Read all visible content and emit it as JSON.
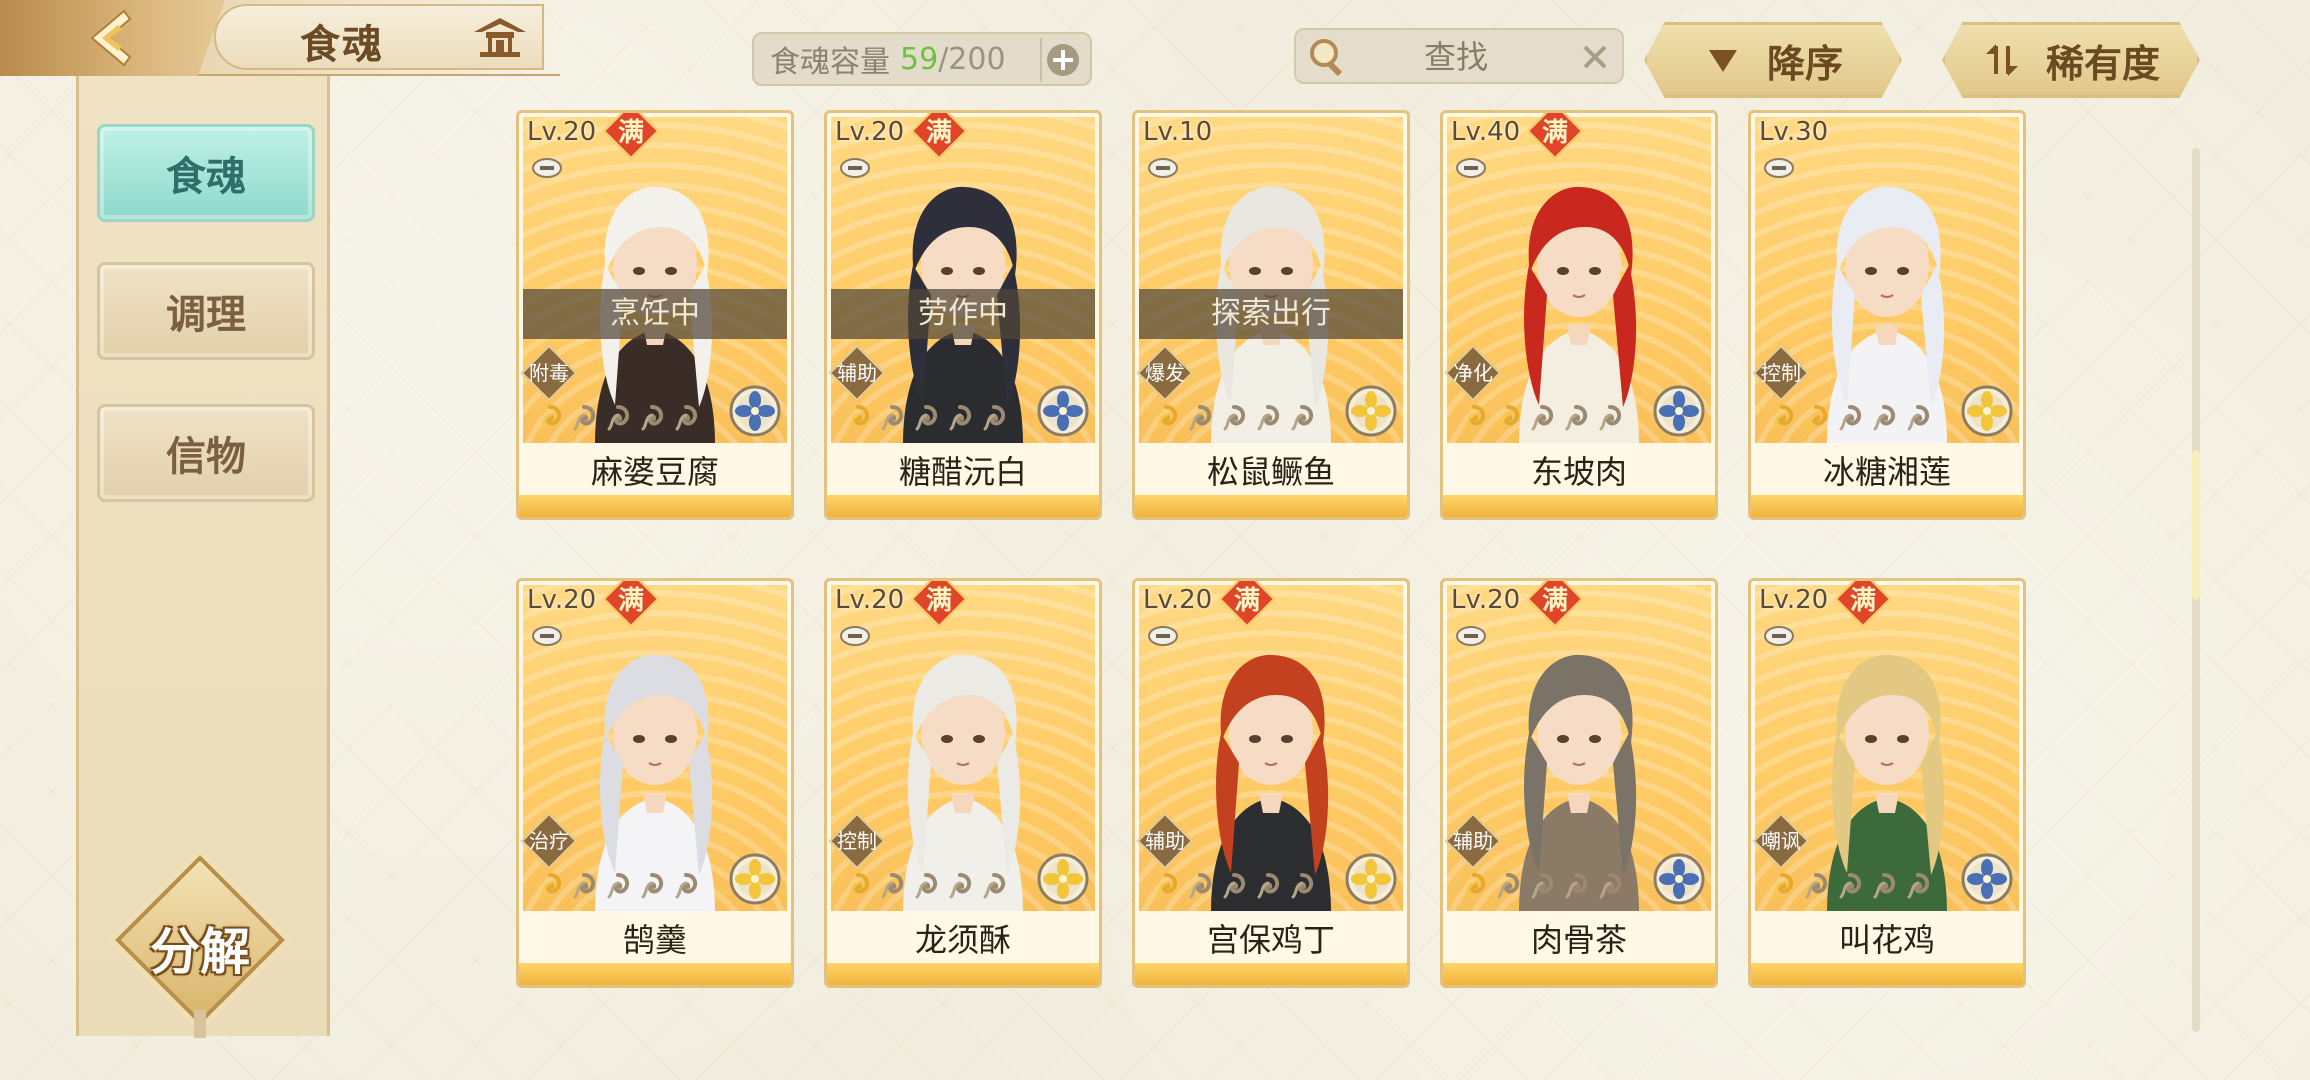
{
  "header": {
    "title": "食魂",
    "capacity": {
      "label": "食魂容量",
      "current": "59",
      "separator": "/",
      "max": "200"
    },
    "search": {
      "placeholder": "查找"
    },
    "sort_label": "降序",
    "rarity_label": "稀有度"
  },
  "sidebar": {
    "tabs": [
      {
        "label": "食魂",
        "active": true
      },
      {
        "label": "调理",
        "active": false
      },
      {
        "label": "信物",
        "active": false
      }
    ],
    "decompose_label": "分解"
  },
  "colors": {
    "accent_gold": "#e3c27e",
    "active_tab": "#8fd9cb",
    "full_badge": "#e0452a",
    "capacity_current": "#6bc33f"
  },
  "cards": [
    {
      "level": "Lv.20",
      "full": "满",
      "status": "烹饪中",
      "role": "附毒",
      "stars_filled": 1,
      "stars_total": 5,
      "name": "麻婆豆腐",
      "element": "blue-flower-icon"
    },
    {
      "level": "Lv.20",
      "full": "满",
      "status": "劳作中",
      "role": "辅助",
      "stars_filled": 1,
      "stars_total": 5,
      "name": "糖醋沅白",
      "element": "blue-flower-icon"
    },
    {
      "level": "Lv.10",
      "full": "",
      "status": "探索出行",
      "role": "爆发",
      "stars_filled": 1,
      "stars_total": 5,
      "name": "松鼠鳜鱼",
      "element": "gold-flower-icon"
    },
    {
      "level": "Lv.40",
      "full": "满",
      "status": "",
      "role": "净化",
      "stars_filled": 2,
      "stars_total": 5,
      "name": "东坡肉",
      "element": "blue-flower-icon"
    },
    {
      "level": "Lv.30",
      "full": "",
      "status": "",
      "role": "控制",
      "stars_filled": 2,
      "stars_total": 5,
      "name": "冰糖湘莲",
      "element": "gold-flower-icon"
    },
    {
      "level": "Lv.20",
      "full": "满",
      "status": "",
      "role": "治疗",
      "stars_filled": 1,
      "stars_total": 5,
      "name": "鹄羹",
      "element": "gold-flower-icon"
    },
    {
      "level": "Lv.20",
      "full": "满",
      "status": "",
      "role": "控制",
      "stars_filled": 1,
      "stars_total": 5,
      "name": "龙须酥",
      "element": "gold-flower-icon"
    },
    {
      "level": "Lv.20",
      "full": "满",
      "status": "",
      "role": "辅助",
      "stars_filled": 1,
      "stars_total": 5,
      "name": "宫保鸡丁",
      "element": "gold-flower-icon"
    },
    {
      "level": "Lv.20",
      "full": "满",
      "status": "",
      "role": "辅助",
      "stars_filled": 1,
      "stars_total": 5,
      "name": "肉骨茶",
      "element": "blue-flower-icon"
    },
    {
      "level": "Lv.20",
      "full": "满",
      "status": "",
      "role": "嘲讽",
      "stars_filled": 1,
      "stars_total": 5,
      "name": "叫花鸡",
      "element": "blue-flower-icon"
    }
  ]
}
